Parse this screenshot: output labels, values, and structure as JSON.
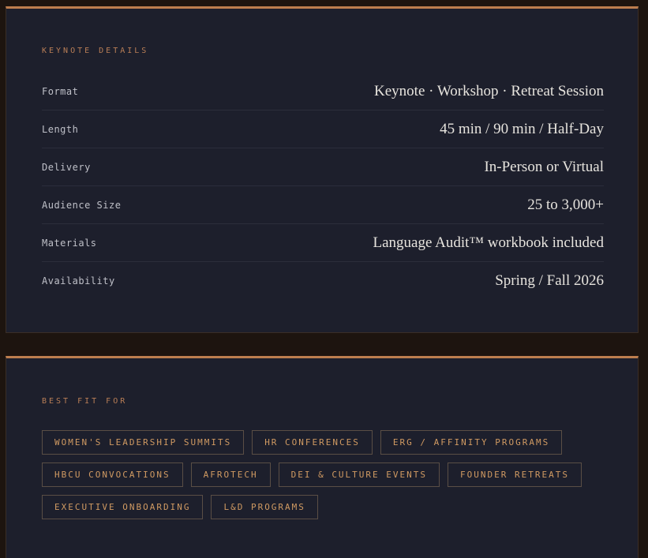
{
  "details": {
    "heading": "KEYNOTE DETAILS",
    "rows": [
      {
        "label": "Format",
        "value": "Keynote · Workshop · Retreat Session"
      },
      {
        "label": "Length",
        "value": "45 min / 90 min / Half-Day"
      },
      {
        "label": "Delivery",
        "value": "In-Person or Virtual"
      },
      {
        "label": "Audience Size",
        "value": "25 to 3,000+"
      },
      {
        "label": "Materials",
        "value": "Language Audit™ workbook included"
      },
      {
        "label": "Availability",
        "value": "Spring / Fall 2026"
      }
    ]
  },
  "best_fit": {
    "heading": "BEST FIT FOR",
    "tags": [
      "WOMEN'S LEADERSHIP SUMMITS",
      "HR CONFERENCES",
      "ERG / AFFINITY PROGRAMS",
      "HBCU CONVOCATIONS",
      "AFROTECH",
      "DEI & CULTURE EVENTS",
      "FOUNDER RETREATS",
      "EXECUTIVE ONBOARDING",
      "L&D PROGRAMS"
    ]
  },
  "colors": {
    "page_background": "#1d140f",
    "card_background": "#1d1f2c",
    "accent": "#bd7e4e",
    "tag_text": "#d09a62"
  }
}
